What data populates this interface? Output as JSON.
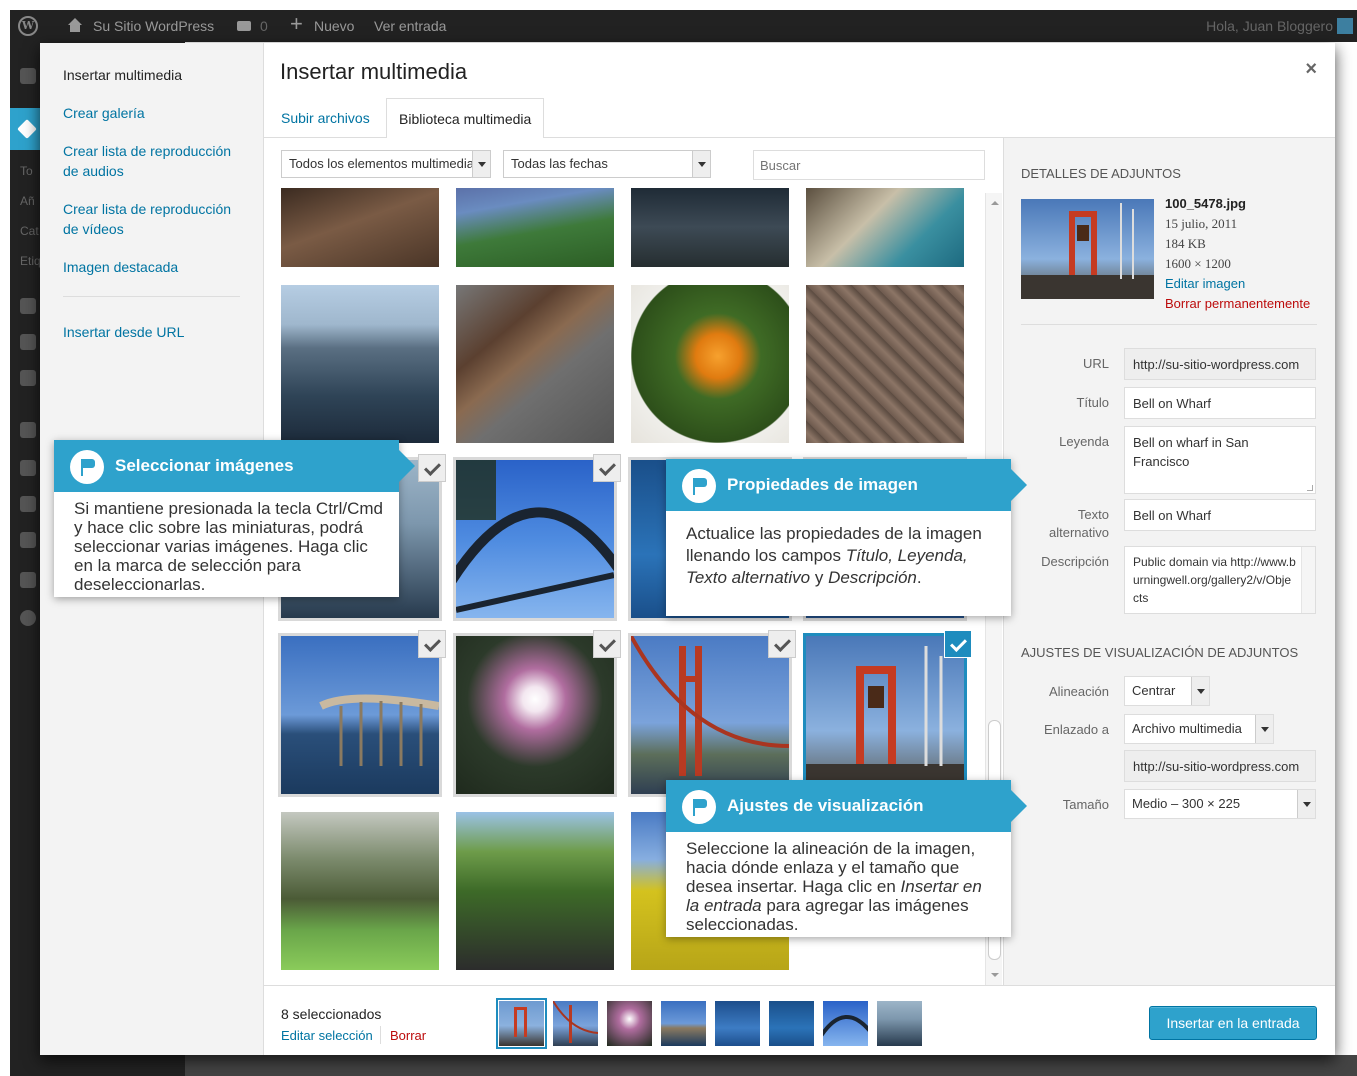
{
  "admin_bar": {
    "site_name": "Su Sitio WordPress",
    "comments_count": "0",
    "new_label": "Nuevo",
    "view_label": "Ver entrada",
    "howdy": "Hola, Juan Bloggero"
  },
  "admin_menu": {
    "partial_labels": [
      "To",
      "Añ",
      "Cat",
      "Etiq"
    ]
  },
  "media_menu": {
    "items": [
      {
        "label": "Insertar multimedia",
        "current": true
      },
      {
        "label": "Crear galería"
      },
      {
        "label": "Crear lista de reproducción de audios"
      },
      {
        "label": "Crear lista de reproducción de vídeos"
      },
      {
        "label": "Imagen destacada"
      },
      {
        "label": "Insertar desde URL"
      }
    ]
  },
  "frame": {
    "title": "Insertar multimedia",
    "close": "×"
  },
  "tabs": [
    {
      "label": "Subir archivos"
    },
    {
      "label": "Biblioteca multimedia",
      "active": true
    }
  ],
  "filters": {
    "type_filter": "Todos los elementos multimedia",
    "date_filter": "Todas las fechas",
    "search_placeholder": "Buscar"
  },
  "attachment_details": {
    "heading": "Detalles de adjuntos",
    "filename": "100_5478.jpg",
    "date": "15 julio, 2011",
    "size": "184 KB",
    "dimensions": "1600 × 1200",
    "edit_link": "Editar imagen",
    "delete_link": "Borrar permanentemente",
    "fields": {
      "url_label": "URL",
      "url_value": "http://su-sitio-wordpress.com",
      "title_label": "Título",
      "title_value": "Bell on Wharf",
      "caption_label": "Leyenda",
      "caption_value": "Bell on wharf in San Francisco",
      "alt_label_1": "Texto",
      "alt_label_2": "alternativo",
      "alt_value": "Bell on Wharf",
      "description_label": "Descripción",
      "description_value": "Public domain via http://www.burningwell.org/gallery2/v/Objects"
    }
  },
  "display_settings": {
    "heading": "Ajustes de visualización de adjuntos",
    "alignment_label": "Alineación",
    "alignment_value": "Centrar",
    "link_to_label": "Enlazado a",
    "link_to_value": "Archivo multimedia",
    "link_url": "http://su-sitio-wordpress.com",
    "size_label": "Tamaño",
    "size_value": "Medio – 300 × 225"
  },
  "selection": {
    "count_label": "8 seleccionados",
    "edit_label": "Editar selección",
    "clear_label": "Borrar"
  },
  "insert_button": "Insertar en la entrada",
  "callouts": {
    "select": {
      "title": "Seleccionar imágenes",
      "body": "Si mantiene presionada la tecla Ctrl/Cmd y hace clic sobre las miniaturas, podrá seleccionar varias imágenes. Haga clic en la marca de selección para deseleccionarlas."
    },
    "properties": {
      "title": "Propiedades de imagen",
      "body_start": "Actualice las propiedades de la imagen llenando los campos ",
      "body_fields": "Título, Leyenda, Texto alternativo",
      "body_and": " y ",
      "body_last": "Descripción",
      "body_end": "."
    },
    "display": {
      "title": "Ajustes de visualización",
      "body_start": "Seleccione la alineación de la imagen, hacia dónde enlaza y el tamaño que desea insertar. Haga clic en ",
      "body_em": "Insertar en la entrada",
      "body_end": " para agregar las imágenes seleccionadas."
    }
  },
  "colors": {
    "accent": "#2ea2cc",
    "link": "#0074a2",
    "danger": "#bc0b0b",
    "admin_bar": "#222222"
  }
}
